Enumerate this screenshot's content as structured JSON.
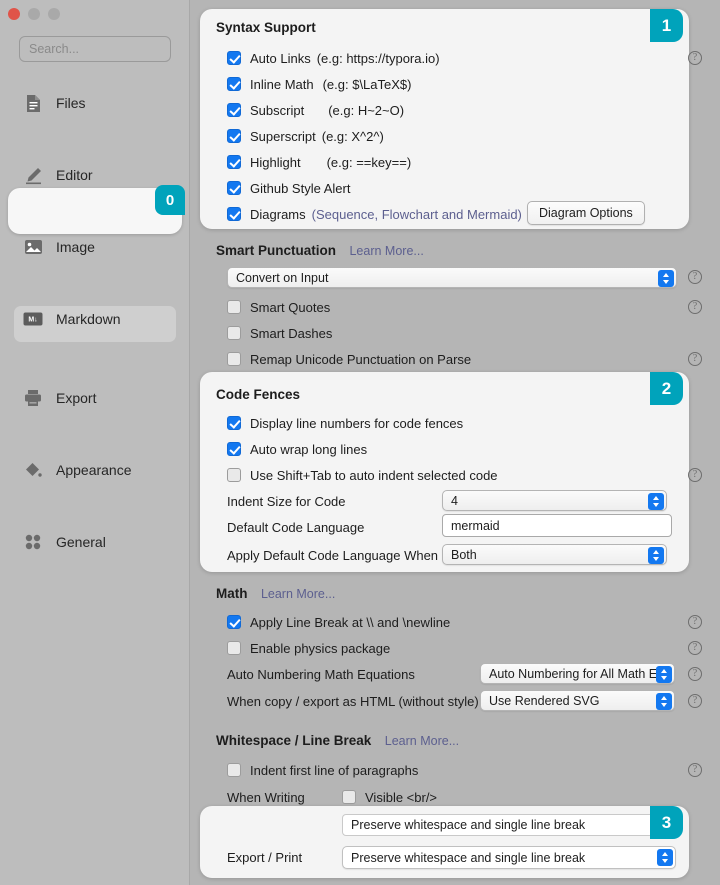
{
  "window": {
    "traffic_lights": [
      "close",
      "minimize",
      "maximize"
    ]
  },
  "sidebar": {
    "search": {
      "placeholder": "Search...",
      "value": ""
    },
    "items": [
      {
        "label": "Files",
        "icon": "file-icon",
        "selected": false
      },
      {
        "label": "Editor",
        "icon": "pencil-icon",
        "selected": false
      },
      {
        "label": "Image",
        "icon": "image-icon",
        "selected": false
      },
      {
        "label": "Markdown",
        "icon": "markdown-icon",
        "selected": true,
        "badge": "0"
      },
      {
        "label": "Export",
        "icon": "printer-icon",
        "selected": false
      },
      {
        "label": "Appearance",
        "icon": "paint-bucket-icon",
        "selected": false
      },
      {
        "label": "General",
        "icon": "grid-icon",
        "selected": false
      }
    ]
  },
  "badges": {
    "syntax": "1",
    "code_fences": "2",
    "whitespace": "3"
  },
  "syntax_support": {
    "title": "Syntax Support",
    "items": [
      {
        "label": "Auto Links",
        "example": "(e.g: https://typora.io)",
        "checked": true
      },
      {
        "label": "Inline Math",
        "example": "(e.g: $\\LaTeX$)",
        "checked": true
      },
      {
        "label": "Subscript",
        "example": "(e.g: H~2~O)",
        "checked": true
      },
      {
        "label": "Superscript",
        "example": "(e.g: X^2^)",
        "checked": true
      },
      {
        "label": "Highlight",
        "example": "(e.g: ==key==)",
        "checked": true
      },
      {
        "label": "Github Style Alert",
        "example": "",
        "checked": true
      },
      {
        "label": "Diagrams",
        "example": "(Sequence, Flowchart and Mermaid)",
        "checked": true,
        "link": true
      }
    ],
    "diagram_options_button": "Diagram Options"
  },
  "smart_punctuation": {
    "title": "Smart Punctuation",
    "learn_more": "Learn More...",
    "mode_select": {
      "value": "Convert on Input"
    },
    "items": [
      {
        "label": "Smart Quotes",
        "checked": false
      },
      {
        "label": "Smart Dashes",
        "checked": false
      },
      {
        "label": "Remap Unicode Punctuation on Parse",
        "checked": false
      }
    ]
  },
  "code_fences": {
    "title": "Code Fences",
    "items": [
      {
        "label": "Display line numbers for code fences",
        "checked": true
      },
      {
        "label": "Auto wrap long lines",
        "checked": true
      },
      {
        "label": "Use Shift+Tab to auto indent selected code",
        "checked": false
      }
    ],
    "indent_size": {
      "label": "Indent Size for Code",
      "value": "4"
    },
    "default_language": {
      "label": "Default Code Language",
      "value": "mermaid"
    },
    "apply_when": {
      "label": "Apply Default Code Language When",
      "value": "Both"
    }
  },
  "math": {
    "title": "Math",
    "learn_more": "Learn More...",
    "items": [
      {
        "label": "Apply Line Break at \\\\ and \\newline",
        "checked": true
      },
      {
        "label": "Enable physics package",
        "checked": false
      }
    ],
    "auto_numbering": {
      "label": "Auto Numbering Math Equations",
      "value": "Auto Numbering for All Math Equ"
    },
    "copy_export": {
      "label": "When copy / export as HTML (without style)",
      "value": "Use Rendered SVG"
    }
  },
  "whitespace": {
    "title": "Whitespace / Line Break",
    "learn_more": "Learn More...",
    "indent_first_line": {
      "label": "Indent first line of paragraphs",
      "checked": false
    },
    "when_writing": {
      "label": "When Writing",
      "visible_br_label": "Visible <br/>",
      "visible_br_checked": false
    },
    "when_writing_select": {
      "value": "Preserve whitespace and single line break"
    },
    "export_print": {
      "label": "Export / Print",
      "value": "Preserve whitespace and single line break"
    }
  },
  "colors": {
    "badge_teal": "#00a3bb",
    "checkbox_blue": "#1378f0",
    "link_purple": "#5c5f8f",
    "window_bg": "#b5b5b5",
    "panel_bg": "#f4f4f4"
  }
}
